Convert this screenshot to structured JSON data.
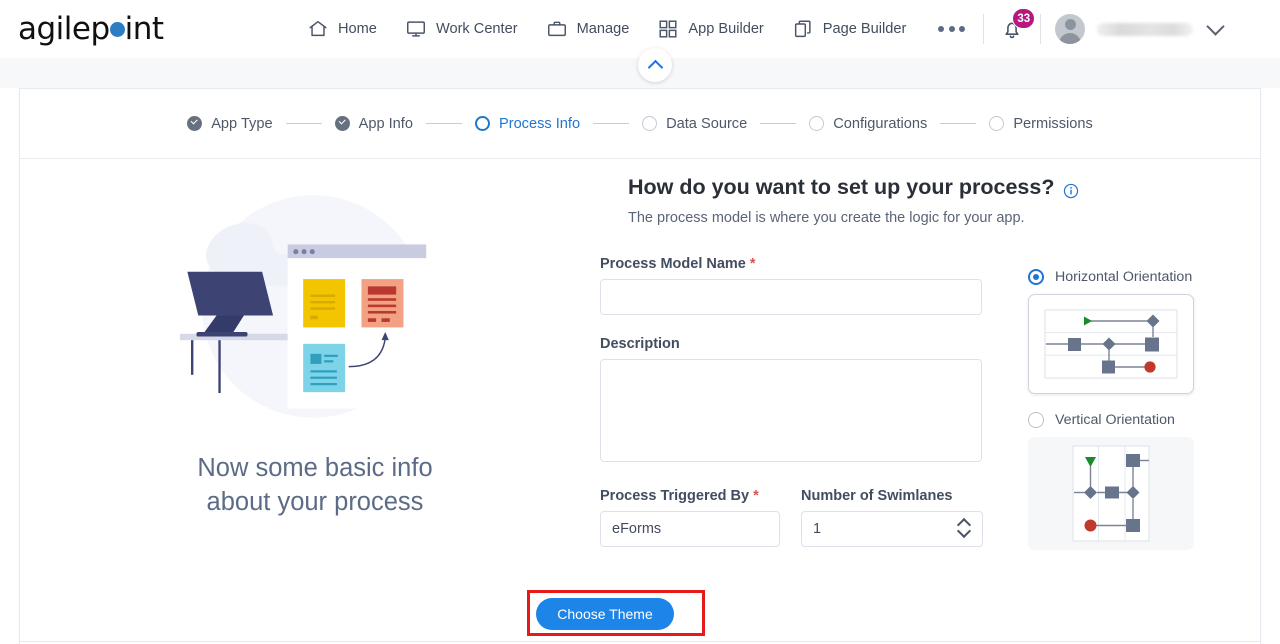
{
  "brand": {
    "name_part1": "agilep",
    "name_part2": "int",
    "dot_color": "#2d7cc4"
  },
  "topnav": {
    "items": [
      {
        "label": "Home",
        "icon": "home-icon"
      },
      {
        "label": "Work Center",
        "icon": "monitor-icon"
      },
      {
        "label": "Manage",
        "icon": "briefcase-icon"
      },
      {
        "label": "App Builder",
        "icon": "grid-icon"
      },
      {
        "label": "Page Builder",
        "icon": "copy-pages-icon"
      }
    ],
    "more_label": "",
    "notifications_count": "33",
    "notifications_badge_color": "#b5187f",
    "username": ""
  },
  "collapse_button": {
    "icon": "chevron-up-icon",
    "color": "#1a73e8"
  },
  "stepper": {
    "steps": [
      {
        "label": "App Type",
        "state": "done"
      },
      {
        "label": "App Info",
        "state": "done"
      },
      {
        "label": "Process Info",
        "state": "active"
      },
      {
        "label": "Data Source",
        "state": "todo"
      },
      {
        "label": "Configurations",
        "state": "todo"
      },
      {
        "label": "Permissions",
        "state": "todo"
      }
    ],
    "active_color": "#1f76d2"
  },
  "left_panel": {
    "caption_line1": "Now some basic info",
    "caption_line2": "about your process",
    "illustration": "desk-monitor-browser-cards-illustration"
  },
  "main": {
    "title": "How do you want to set up your process?",
    "info_icon": "info-circle-icon",
    "subtitle": "The process model is where you create the logic for your app.",
    "fields": {
      "process_model_name": {
        "label": "Process Model Name",
        "required": "*",
        "value": "",
        "placeholder": ""
      },
      "description": {
        "label": "Description",
        "required": "",
        "value": "",
        "placeholder": ""
      },
      "process_triggered_by": {
        "label": "Process Triggered By",
        "required": "*",
        "value": "eForms",
        "options": [
          "eForms"
        ]
      },
      "number_of_swimlanes": {
        "label": "Number of Swimlanes",
        "required": "",
        "value": "1"
      }
    },
    "orientation": {
      "horizontal": {
        "label": "Horizontal Orientation",
        "selected": true
      },
      "vertical": {
        "label": "Vertical Orientation",
        "selected": false
      }
    },
    "choose_theme_button": {
      "label": "Choose Theme",
      "color": "#1e85e8",
      "highlight_color": "#e8191a"
    }
  }
}
